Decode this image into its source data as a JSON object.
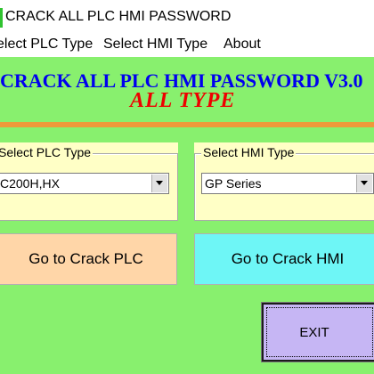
{
  "window": {
    "title": "CRACK ALL PLC HMI PASSWORD",
    "icon": "app-icon",
    "background": "#88f06e"
  },
  "menu": {
    "items": [
      "elect PLC Type",
      "Select HMI Type",
      "About"
    ]
  },
  "heading": {
    "main": "CRACK ALL PLC HMI PASSWORD V3.0",
    "sub": "ALL  TYPE",
    "main_color": "#0000ee",
    "sub_color": "#ee0000"
  },
  "plc_group": {
    "legend": "Select PLC Type",
    "selected": "C200H,HX",
    "background": "#ffffc6"
  },
  "hmi_group": {
    "legend": "Select HMI Type",
    "selected": "GP Series",
    "background": "#ffffc6"
  },
  "buttons": {
    "crack_plc": {
      "label": "Go to Crack PLC",
      "color": "#ffd6a8"
    },
    "crack_hmi": {
      "label": "Go to Crack HMI",
      "color": "#6ef6f6"
    },
    "exit": {
      "label": "EXIT",
      "color": "#c6b6f4"
    }
  }
}
